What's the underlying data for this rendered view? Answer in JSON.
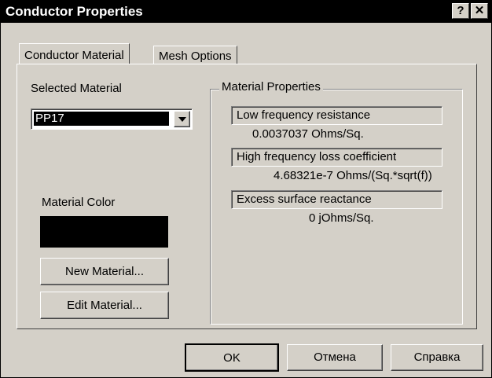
{
  "window": {
    "title": "Conductor Properties",
    "help_btn": "?",
    "close_btn": "✕"
  },
  "tabs": [
    {
      "label": "Conductor Material",
      "active": true
    },
    {
      "label": "Mesh Options",
      "active": false
    }
  ],
  "left": {
    "selected_material_label": "Selected Material",
    "selected_material_value": "PP17",
    "material_color_label": "Material Color",
    "material_color": "#000000",
    "new_material_button": "New Material...",
    "edit_material_button": "Edit Material..."
  },
  "properties": {
    "group_title": "Material Properties",
    "items": [
      {
        "label": "Low frequency resistance",
        "value": "0.0037037 Ohms/Sq."
      },
      {
        "label": "High frequency loss coefficient",
        "value": "4.68321e-7 Ohms/(Sq.*sqrt(f))"
      },
      {
        "label": "Excess surface reactance",
        "value": "0 jOhms/Sq."
      }
    ]
  },
  "footer": {
    "ok": "OK",
    "cancel": "Отмена",
    "help": "Справка"
  }
}
